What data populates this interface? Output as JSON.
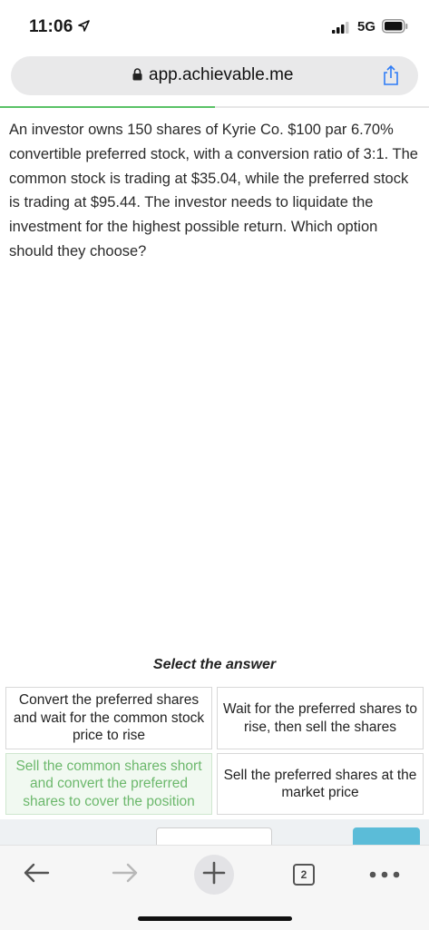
{
  "status": {
    "time": "11:06",
    "network": "5G"
  },
  "browser": {
    "url": "app.achievable.me",
    "open_tabs": "2"
  },
  "quiz": {
    "progress_fraction": 0.5,
    "progress_color": "#59c266",
    "question": "An investor owns 150 shares of Kyrie Co. $100 par 6.70% convertible preferred stock, with a conversion ratio of 3:1. The common stock is trading at $35.04, while the preferred stock is trading at $95.44. The investor needs to liquidate the investment for the highest possible return. Which option should they choose?",
    "select_label": "Select the answer",
    "options": [
      {
        "text": "Convert the preferred shares and wait for the common stock price to rise"
      },
      {
        "text": "Wait for the preferred shares to rise, then sell the shares"
      },
      {
        "text": "Sell the common shares short and convert the preferred shares to cover the position"
      },
      {
        "text": "Sell the preferred shares at the market price"
      }
    ],
    "highlight_color": "#6cb86c",
    "next_color": "#5bbcd8"
  },
  "icons": {
    "back": "arrow-left-icon",
    "forward": "arrow-right-icon",
    "new_tab": "plus-icon",
    "tabs": "tabs-icon",
    "more": "ellipsis-icon",
    "share": "share-icon",
    "lock": "lock-icon"
  }
}
